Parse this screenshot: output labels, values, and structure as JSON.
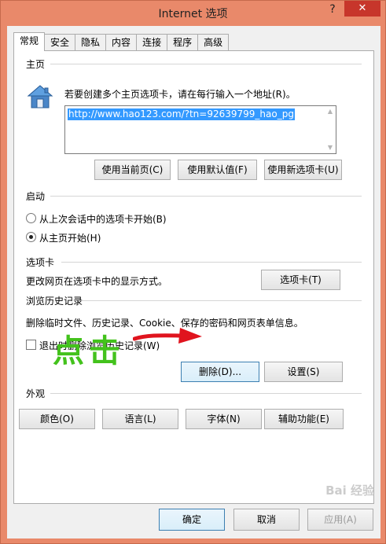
{
  "window": {
    "title": "Internet 选项",
    "help_label": "?",
    "close_label": "✕"
  },
  "tabs": [
    {
      "label": "常规",
      "active": true
    },
    {
      "label": "安全"
    },
    {
      "label": "隐私"
    },
    {
      "label": "内容"
    },
    {
      "label": "连接"
    },
    {
      "label": "程序"
    },
    {
      "label": "高级"
    }
  ],
  "homepage": {
    "section_label": "主页",
    "instruction": "若要创建多个主页选项卡，请在每行输入一个地址(R)。",
    "url_value": "http://www.hao123.com/?tn=92639799_hao_pg",
    "btn_use_current": "使用当前页(C)",
    "btn_use_default": "使用默认值(F)",
    "btn_use_new_tab": "使用新选项卡(U)",
    "icon": "house-icon"
  },
  "startup": {
    "section_label": "启动",
    "option_last_session": "从上次会话中的选项卡开始(B)",
    "option_homepage": "从主页开始(H)",
    "selected": "option_homepage"
  },
  "tabs_section": {
    "section_label": "选项卡",
    "description": "更改网页在选项卡中的显示方式。",
    "btn_tabs": "选项卡(T)"
  },
  "history": {
    "section_label": "浏览历史记录",
    "description": "删除临时文件、历史记录、Cookie、保存的密码和网页表单信息。",
    "checkbox_delete_on_exit": "退出时删除浏览历史记录(W)",
    "checkbox_checked": false,
    "btn_delete": "删除(D)...",
    "btn_settings": "设置(S)"
  },
  "appearance": {
    "section_label": "外观",
    "btn_colors": "颜色(O)",
    "btn_languages": "语言(L)",
    "btn_fonts": "字体(N)",
    "btn_accessibility": "辅助功能(E)"
  },
  "dialog_buttons": {
    "ok": "确定",
    "cancel": "取消",
    "apply": "应用(A)"
  },
  "annotation": {
    "text": "点击",
    "color": "#43c21c",
    "arrow_color": "#e0141e"
  },
  "watermark": "Bai 经验"
}
